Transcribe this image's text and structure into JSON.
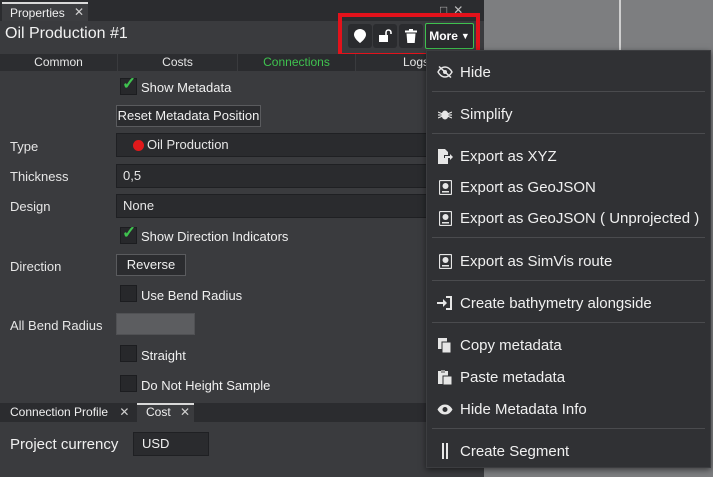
{
  "tab": {
    "label": "Properties"
  },
  "object_title": "Oil Production #1",
  "toolbar": {
    "more_label": "More"
  },
  "subtabs": [
    {
      "label": "Common",
      "active": false
    },
    {
      "label": "Costs",
      "active": false
    },
    {
      "label": "Connections",
      "active": true
    },
    {
      "label": "Logs",
      "active": false
    }
  ],
  "form": {
    "show_metadata": {
      "label": "Show Metadata",
      "checked": true
    },
    "reset_metadata_button": "Reset Metadata Position",
    "type": {
      "label": "Type",
      "value": "Oil Production",
      "color": "#e0191b"
    },
    "thickness": {
      "label": "Thickness",
      "value": "0,5"
    },
    "design": {
      "label": "Design",
      "value": "None"
    },
    "show_direction": {
      "label": "Show Direction Indicators",
      "checked": true
    },
    "direction": {
      "label": "Direction",
      "button": "Reverse"
    },
    "use_bend_radius": {
      "label": "Use Bend Radius",
      "checked": false
    },
    "all_bend_radius": {
      "label": "All Bend Radius",
      "value": ""
    },
    "straight": {
      "label": "Straight",
      "checked": false
    },
    "no_height_sample": {
      "label": "Do Not Height Sample",
      "checked": false
    }
  },
  "bottom_tabs": [
    {
      "label": "Connection Profile"
    },
    {
      "label": "Cost"
    }
  ],
  "currency": {
    "label": "Project currency",
    "value": "USD"
  },
  "menu": {
    "hide": {
      "label": "Hide",
      "icon": "eye-slash-icon"
    },
    "simplify": {
      "label": "Simplify",
      "icon": "bug-icon"
    },
    "export_xyz": {
      "label": "Export as XYZ",
      "icon": "export-icon"
    },
    "export_geojson": {
      "label": "Export as GeoJSON",
      "icon": "geojson-icon"
    },
    "export_geojson_unprojected": {
      "label": "Export as GeoJSON ( Unprojected )",
      "icon": "geojson-icon"
    },
    "export_simvis": {
      "label": "Export as SimVis route",
      "icon": "simvis-icon"
    },
    "create_bathymetry": {
      "label": "Create bathymetry alongside",
      "icon": "sign-in-icon"
    },
    "copy_metadata": {
      "label": "Copy metadata",
      "icon": "copy-icon"
    },
    "paste_metadata": {
      "label": "Paste metadata",
      "icon": "paste-icon"
    },
    "hide_metadata_info": {
      "label": "Hide Metadata Info",
      "icon": "eye-icon"
    },
    "create_segment": {
      "label": "Create Segment",
      "icon": "segment-icon"
    }
  },
  "colors": {
    "accent": "#3fc24f",
    "highlight": "#e3121b"
  }
}
